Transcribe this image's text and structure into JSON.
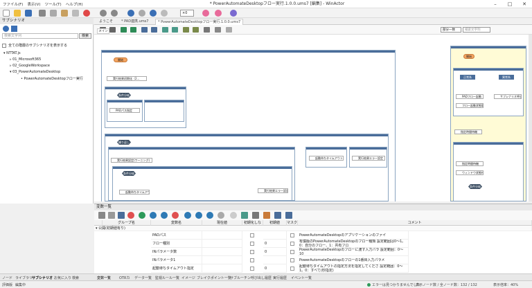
{
  "window": {
    "title": "* PowerAutomateDesktopフロー実行.1.0.0.ums7 [編集] - WinActor"
  },
  "menu": [
    "ファイル(F)",
    "表示(V)",
    "ツール(T)",
    "ヘルプ(H)"
  ],
  "toolbar": {
    "zoom_value": "×0"
  },
  "left_panel": {
    "title": "サブシナリオ",
    "search_placeholder": "検索文字列",
    "search_button": "検索",
    "show_all_label": "全ての階層のサブシナリオを表示する",
    "tree": [
      {
        "label": "NTTAT.js",
        "level": 0
      },
      {
        "label": "01_Microsoft365",
        "level": 1
      },
      {
        "label": "02_GoogleWorkspace",
        "level": 1
      },
      {
        "label": "03_PowerAutomateDesktop",
        "level": 1
      },
      {
        "label": "PowerAutomateDesktopフロー実行",
        "level": 2
      }
    ]
  },
  "tabs": [
    "ようこそ",
    "* PAD連携.ums7",
    "* PowerAutomateDesktopフロー実行.1.0.0.ums7"
  ],
  "subtab": "メイン",
  "search_group": {
    "select": "部分一致",
    "placeholder": "検索文字列"
  },
  "canvas": {
    "start_label": "開始",
    "nodes": [
      "実行結果初期化（2...",
      "PADパス指定",
      "実行結果設定(ワーニング)",
      "PADフロー起動",
      "フロー起動状態取得",
      "指定時間待機",
      "起動待ちタイムアウト",
      "実行結果エラー設定",
      "サブシナリオ呼出",
      "ウィンドウ状態待機"
    ],
    "branch_labels": [
      "条件分岐",
      "繰り返し",
      "正常系",
      "異常系"
    ]
  },
  "bottom": {
    "title": "変数一覧",
    "headers": [
      "グループ名",
      "変数名",
      "現在値",
      "初期化しない",
      "初期値",
      "マスク",
      "コメント"
    ],
    "group_row": "公開(初期値有り)",
    "rows": [
      {
        "name": "PADパス",
        "value": "",
        "init": "",
        "comment": "PowerAutomateDesktopのアプリケーションのファイ"
      },
      {
        "name": "フロー種別",
        "value": "",
        "init": "0",
        "comment": "有償版のPowerAutomateDesktopのフロー種類 設定範囲は0〜1。0：自分のフロー、1：共有フロ"
      },
      {
        "name": "INパラメータ数",
        "value": "",
        "init": "0",
        "comment": "PowerAutomateDesktopのフローに渡す入力パラ 設定範囲：0〜10"
      },
      {
        "name": "INパラメータ1",
        "value": "",
        "init": "",
        "comment": "PowerAutomateDesktopのフローの1番目入力パラメ"
      },
      {
        "name": "起動待ちタイムアウト指定",
        "value": "",
        "init": "0",
        "comment": "起動待ちタイムアウトの指定方法を指定してくださ 設定範囲：0〜1。0：すべて(秒指定)"
      }
    ]
  },
  "bottom_tabs": [
    "ノード",
    "ライブラリ",
    "サブシナリオ",
    "お気に入り",
    "検索"
  ],
  "bottom_tabs2": [
    "変数一覧",
    "OTRカ",
    "データ一覧",
    "監視ルール一覧",
    "イメージ",
    "ブレイクポイント一覧",
    "サブルーチン",
    "呼び出し履歴",
    "実行履歴",
    "イベント一覧"
  ],
  "status": {
    "left": "評価版",
    "mode": "編集中",
    "errors": "エラーは見つかりませんでした",
    "node_count": "表示ノード数 / 全ノード数：132 / 132",
    "zoom": "表示倍率：40%"
  },
  "colors": {
    "accent": "#4a6d9a",
    "start_pill": "#f4a460",
    "diamond": "#3d4f63",
    "highlight_area": "#fffbd6"
  }
}
